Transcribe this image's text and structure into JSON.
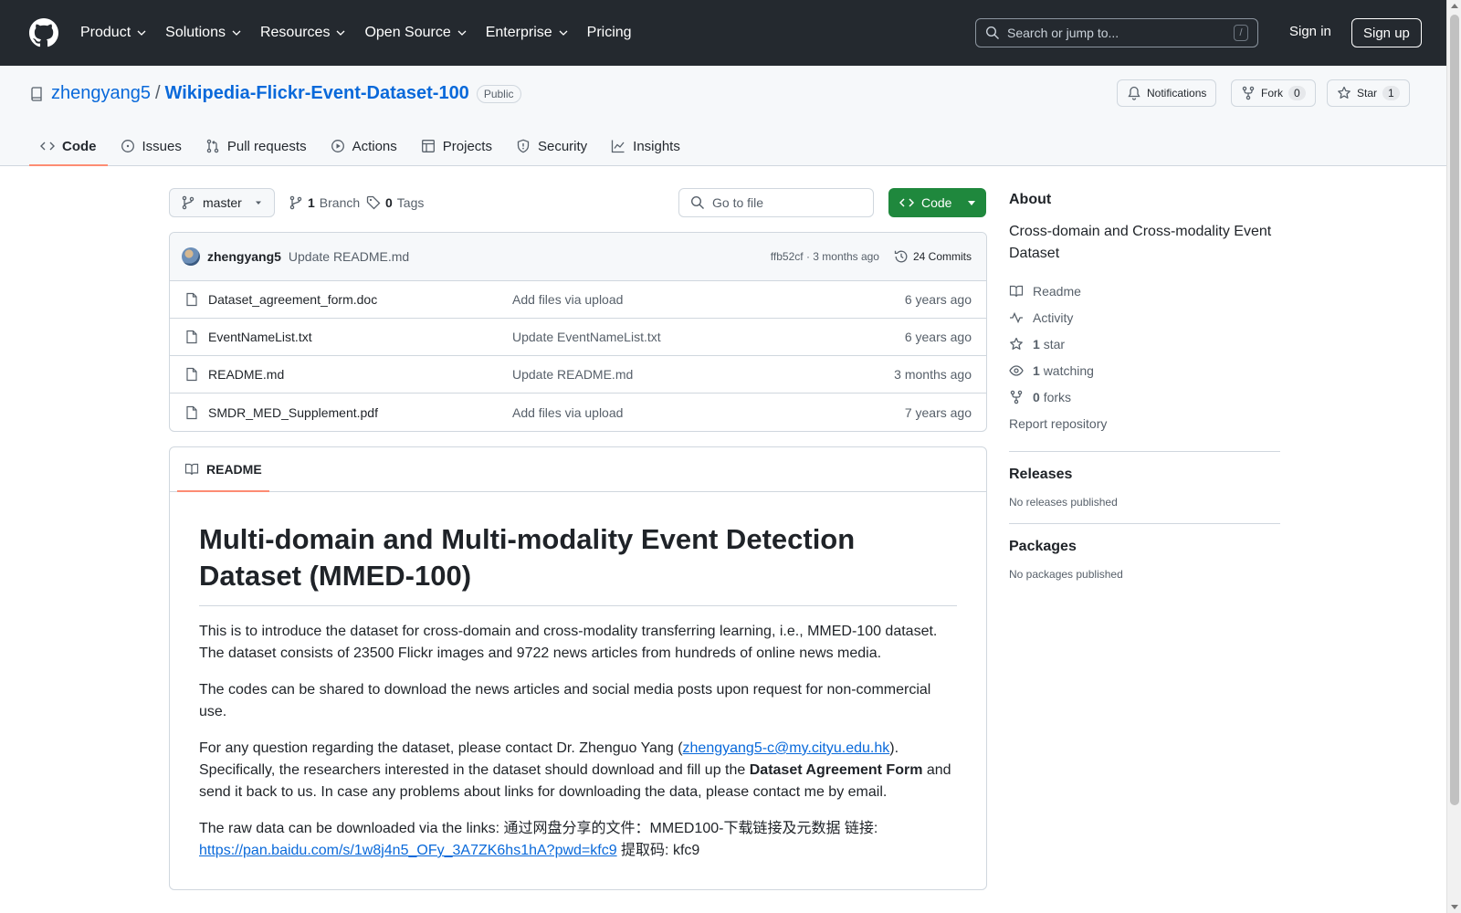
{
  "header": {
    "nav": [
      "Product",
      "Solutions",
      "Resources",
      "Open Source",
      "Enterprise",
      "Pricing"
    ],
    "search_placeholder": "Search or jump to...",
    "slash": "/",
    "sign_in": "Sign in",
    "sign_up": "Sign up"
  },
  "repo": {
    "owner": "zhengyang5",
    "sep": "/",
    "name": "Wikipedia-Flickr-Event-Dataset-100",
    "visibility": "Public",
    "notifications_label": "Notifications",
    "fork_label": "Fork",
    "fork_count": "0",
    "star_label": "Star",
    "star_count": "1"
  },
  "tabs": [
    "Code",
    "Issues",
    "Pull requests",
    "Actions",
    "Projects",
    "Security",
    "Insights"
  ],
  "toolbar": {
    "branch": "master",
    "branch_count": "1",
    "branch_label": "Branch",
    "tag_count": "0",
    "tag_label": "Tags",
    "goto_placeholder": "Go to file",
    "code_label": "Code"
  },
  "commit": {
    "author": "zhengyang5",
    "message": "Update README.md",
    "hash_age": "ffb52cf · 3 months ago",
    "commits": "24 Commits"
  },
  "files": [
    {
      "name": "Dataset_agreement_form.doc",
      "message": "Add files via upload",
      "age": "6 years ago"
    },
    {
      "name": "EventNameList.txt",
      "message": "Update EventNameList.txt",
      "age": "6 years ago"
    },
    {
      "name": "README.md",
      "message": "Update README.md",
      "age": "3 months ago"
    },
    {
      "name": "SMDR_MED_Supplement.pdf",
      "message": "Add files via upload",
      "age": "7 years ago"
    }
  ],
  "readme": {
    "tab": "README",
    "title": "Multi-domain and Multi-modality Event Detection Dataset (MMED-100)",
    "p1": "This is to introduce the dataset for cross-domain and cross-modality transferring learning, i.e., MMED-100 dataset. The dataset consists of 23500 Flickr images and 9722 news articles from hundreds of online news media.",
    "p2": "The codes can be shared to download the news articles and social media posts upon request for non-commercial use.",
    "p3a": "For any question regarding the dataset, please contact Dr. Zhenguo Yang (",
    "p3_email": "zhengyang5-c@my.cityu.edu.hk",
    "p3b": "). Specifically, the researchers interested in the dataset should download and fill up the ",
    "p3_bold": "Dataset Agreement Form",
    "p3c": " and send it back to us. In case any problems about links for downloading the data, please contact me by email.",
    "p4a": "The raw data can be downloaded via the links: 通过网盘分享的文件：MMED100-下载链接及元数据 链接: ",
    "p4_link": "https://pan.baidu.com/s/1w8j4n5_OFy_3A7ZK6hs1hA?pwd=kfc9",
    "p4b": " 提取码: kfc9"
  },
  "sidebar": {
    "about_title": "About",
    "description": "Cross-domain and Cross-modality Event Dataset",
    "readme": "Readme",
    "activity": "Activity",
    "stars_count": "1",
    "stars_label": "star",
    "watching_count": "1",
    "watching_label": "watching",
    "forks_count": "0",
    "forks_label": "forks",
    "report": "Report repository",
    "releases_title": "Releases",
    "releases_none": "No releases published",
    "packages_title": "Packages",
    "packages_none": "No packages published"
  }
}
